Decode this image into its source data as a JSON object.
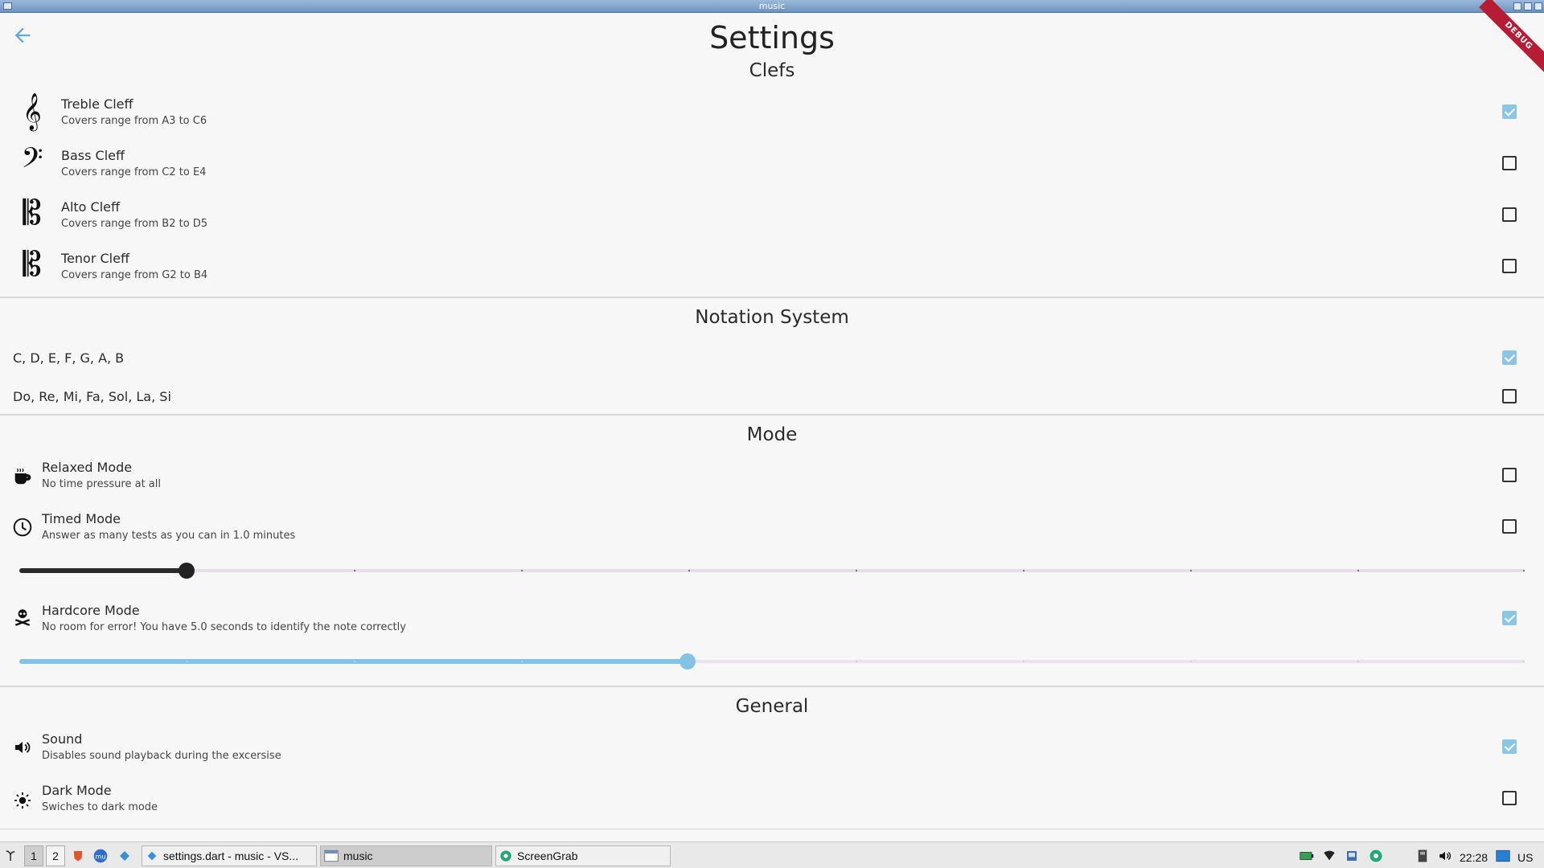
{
  "window": {
    "title": "music",
    "debug_banner": "DEBUG"
  },
  "page": {
    "title": "Settings"
  },
  "sections": {
    "clefs": {
      "title": "Clefs"
    },
    "notation": {
      "title": "Notation System"
    },
    "mode": {
      "title": "Mode"
    },
    "general": {
      "title": "General"
    }
  },
  "clefs": [
    {
      "label": "Treble Cleff",
      "sub": "Covers range from A3 to C6",
      "checked": true,
      "icon": "treble-clef-icon"
    },
    {
      "label": "Bass Cleff",
      "sub": "Covers range from C2 to E4",
      "checked": false,
      "icon": "bass-clef-icon"
    },
    {
      "label": "Alto Cleff",
      "sub": "Covers range from B2 to D5",
      "checked": false,
      "icon": "alto-clef-icon"
    },
    {
      "label": "Tenor Cleff",
      "sub": "Covers range from G2 to B4",
      "checked": false,
      "icon": "tenor-clef-icon"
    }
  ],
  "notation": [
    {
      "label": "C, D, E, F, G, A, B",
      "checked": true
    },
    {
      "label": "Do, Re, Mi, Fa, Sol, La, Si",
      "checked": false
    }
  ],
  "modes": {
    "relaxed": {
      "label": "Relaxed Mode",
      "sub": "No time pressure at all",
      "checked": false,
      "icon": "coffee-cup-icon"
    },
    "timed": {
      "label": "Timed Mode",
      "sub": "Answer as many tests as you can in 1.0 minutes",
      "checked": false,
      "icon": "clock-icon",
      "slider_fraction": 0.111,
      "slider_divisions": 9
    },
    "hardcore": {
      "label": "Hardcore Mode",
      "sub": "No room for error! You have 5.0 seconds to identify the note correctly",
      "checked": true,
      "icon": "skull-crossbones-icon",
      "slider_fraction": 0.444,
      "slider_divisions": 9
    }
  },
  "general": {
    "sound": {
      "label": "Sound",
      "sub": "Disables sound playback during the excersise",
      "checked": true,
      "icon": "speaker-icon"
    },
    "dark": {
      "label": "Dark Mode",
      "sub": "Swiches to dark mode",
      "checked": false,
      "icon": "sun-icon"
    }
  },
  "taskbar": {
    "workspaces": [
      "1",
      "2"
    ],
    "tasks": [
      {
        "label": "settings.dart - music - VS..."
      },
      {
        "label": "music"
      },
      {
        "label": "ScreenGrab"
      }
    ],
    "clock": "22:28",
    "locale": "US"
  },
  "colors": {
    "accent": "#82c3e6",
    "checked": "#8cc6e6",
    "back_arrow": "#5fa9d9",
    "debug": "#b71c35"
  }
}
